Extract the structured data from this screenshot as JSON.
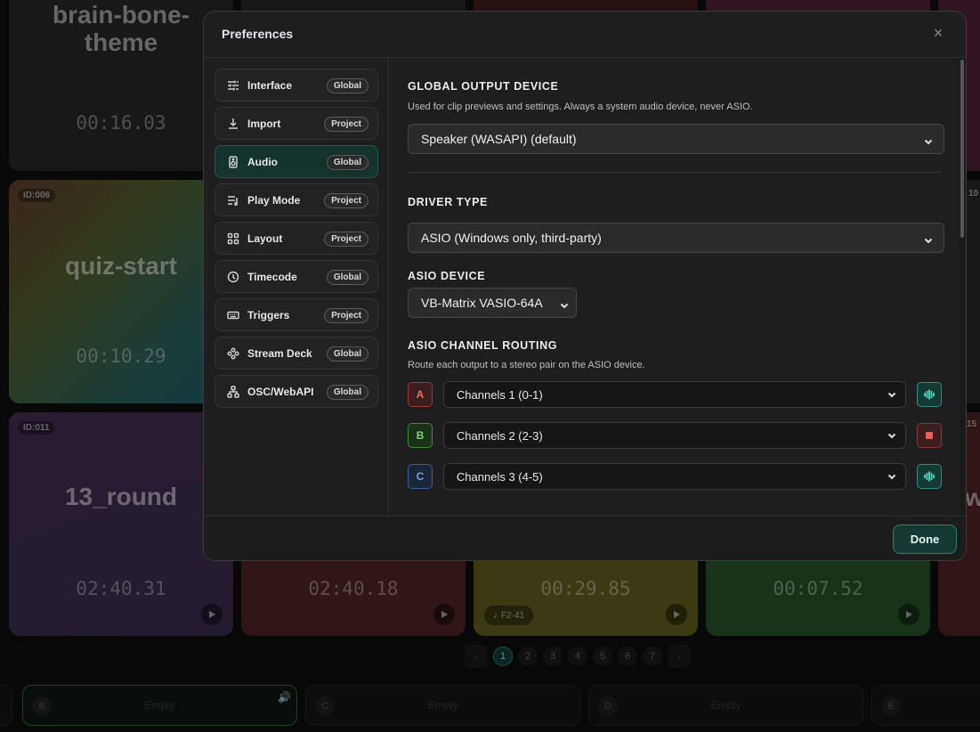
{
  "background": {
    "cards": [
      {
        "title": "brain-bone-theme",
        "time": "00:16.03"
      },
      {
        "id_label": "ID:006",
        "title": "quiz-start",
        "time": "00:10.29"
      },
      {
        "id_label": "ID:011",
        "title": "13_round",
        "time": "02:40.31"
      },
      {
        "time": "02:40.18"
      },
      {
        "time": "00:29.85",
        "note": "F2·41"
      },
      {
        "time": "00:07.52"
      },
      {
        "id_fragment": "10"
      },
      {
        "id_fragment": "15"
      },
      {
        "title_fragment": "w"
      }
    ],
    "pages": [
      "1",
      "2",
      "3",
      "4",
      "5",
      "6",
      "7"
    ],
    "active_page": "1",
    "decks": [
      {
        "letter": "B",
        "text": "Empty"
      },
      {
        "letter": "C",
        "text": "Empty"
      },
      {
        "letter": "D",
        "text": "Empty"
      },
      {
        "letter": "E",
        "text": ""
      }
    ]
  },
  "modal": {
    "title": "Preferences",
    "done_label": "Done",
    "nav": [
      {
        "label": "Interface",
        "badge": "Global",
        "icon": "sliders-icon"
      },
      {
        "label": "Import",
        "badge": "Project",
        "icon": "download-icon"
      },
      {
        "label": "Audio",
        "badge": "Global",
        "icon": "speaker-icon",
        "active": true
      },
      {
        "label": "Play Mode",
        "badge": "Project",
        "icon": "playlist-icon"
      },
      {
        "label": "Layout",
        "badge": "Project",
        "icon": "grid-icon"
      },
      {
        "label": "Timecode",
        "badge": "Global",
        "icon": "clock-icon"
      },
      {
        "label": "Triggers",
        "badge": "Project",
        "icon": "keyboard-icon"
      },
      {
        "label": "Stream Deck",
        "badge": "Global",
        "icon": "stream-deck-icon"
      },
      {
        "label": "OSC/WebAPI",
        "badge": "Global",
        "icon": "network-icon"
      }
    ],
    "audio": {
      "output_title": "GLOBAL OUTPUT DEVICE",
      "output_desc": "Used for clip previews and settings. Always a system audio device, never ASIO.",
      "output_value": "Speaker (WASAPI) (default)",
      "driver_title": "DRIVER TYPE",
      "driver_value": "ASIO (Windows only, third-party)",
      "asio_device_title": "ASIO DEVICE",
      "asio_device_value": "VB-Matrix VASIO-64A",
      "routing_title": "ASIO CHANNEL ROUTING",
      "routing_desc": "Route each output to a stereo pair on the ASIO device.",
      "routes": [
        {
          "letter": "A",
          "channel": "Channels 1 (0-1)",
          "button": "wave"
        },
        {
          "letter": "B",
          "channel": "Channels 2 (2-3)",
          "button": "stop"
        },
        {
          "letter": "C",
          "channel": "Channels 3 (4-5)",
          "button": "wave"
        }
      ]
    }
  },
  "colors": {
    "accent_teal": "#2e7e6e",
    "deck_a": "#9c3535",
    "deck_b": "#3f8a3a",
    "deck_c": "#3a5d96"
  }
}
